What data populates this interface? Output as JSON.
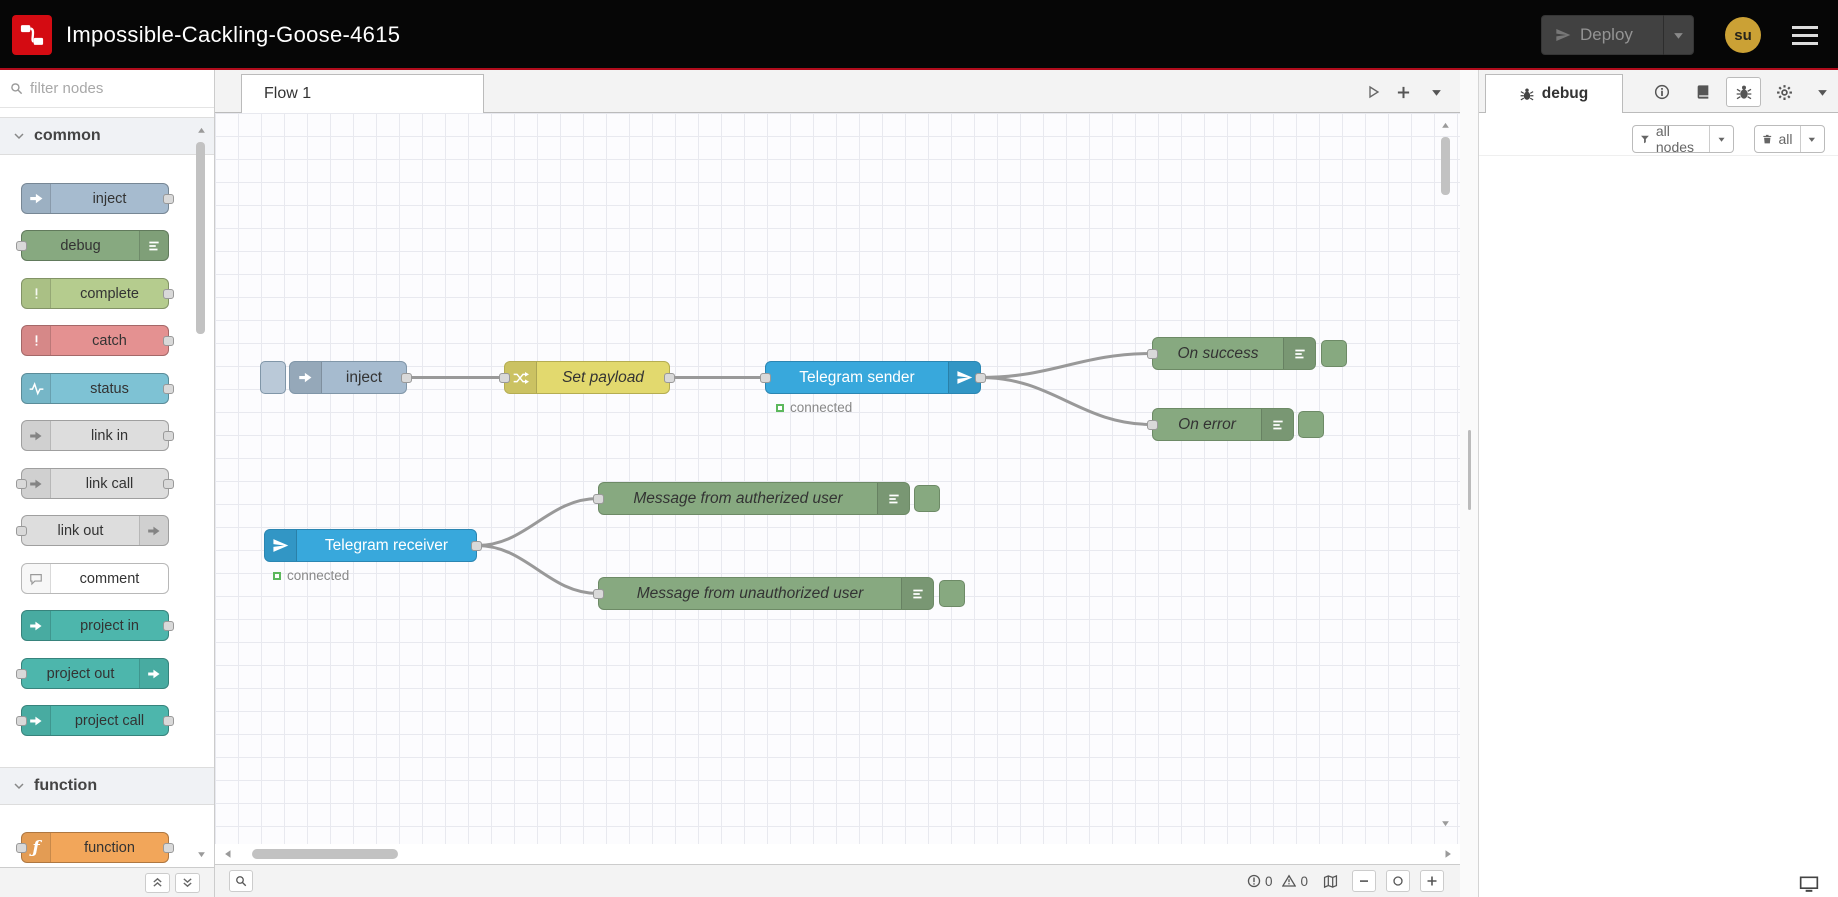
{
  "header": {
    "title": "Impossible-Cackling-Goose-4615",
    "deploy_label": "Deploy",
    "user_initials": "su"
  },
  "palette": {
    "filter_placeholder": "filter nodes",
    "categories": [
      {
        "label": "common"
      },
      {
        "label": "function"
      }
    ],
    "common_items": [
      "inject",
      "debug",
      "complete",
      "catch",
      "status",
      "link in",
      "link call",
      "link out",
      "comment",
      "project in",
      "project out",
      "project call"
    ],
    "function_items": [
      "function"
    ]
  },
  "workspace": {
    "tab_label": "Flow 1",
    "nodes": {
      "inject": {
        "label": "inject"
      },
      "set_payload": {
        "label": "Set payload"
      },
      "telegram_sender": {
        "label": "Telegram sender",
        "status": "connected"
      },
      "on_success": {
        "label": "On success"
      },
      "on_error": {
        "label": "On error"
      },
      "telegram_receiver": {
        "label": "Telegram receiver",
        "status": "connected"
      },
      "message_authorized": {
        "label": "Message from autherized user"
      },
      "message_unauthorized": {
        "label": "Message from unauthorized user"
      }
    },
    "statusbar": {
      "errors": "0",
      "warnings": "0"
    }
  },
  "sidebar": {
    "tab_label": "debug",
    "filter_button_label": "all nodes",
    "clear_button_label": "all"
  },
  "colors": {
    "header_bg": "#060606",
    "header_accent": "#b10c1c",
    "logo_red": "#d40b12",
    "avatar_gold": "#cba135",
    "node_inject": "#a6bbcf",
    "node_debug_green": "#87a980",
    "node_complete": "#b5cc8e",
    "node_catch": "#e49191",
    "node_status": "#7ec2d4",
    "node_link": "#dddddd",
    "node_comment": "#ffffff",
    "node_project": "#4db6ac",
    "node_function": "#f2a65a",
    "node_telegram_blue": "#38a8dc",
    "node_change_yellow": "#e2d96e",
    "status_connected_green": "#5cb85c",
    "wire": "#999999"
  },
  "icons": {
    "search": "magnifier-shape",
    "menu": "hamburger-bars",
    "deploy": "paper-plane",
    "telegram": "paper-plane",
    "inject": "arrow-right",
    "debug_list": "list-lines",
    "catch_complete": "exclamation-mark",
    "status_pulse": "heartbeat-line",
    "link": "arrow-right",
    "comment": "speech-bubble",
    "change": "shuffle-arrows",
    "function_glyph": "ƒ",
    "bug": "bug-shape",
    "info": "circle-i",
    "book": "book-shape",
    "gear": "gear-shape",
    "funnel": "funnel-shape",
    "trash": "trash-can",
    "map": "folded-map",
    "monitor": "monitor-screen"
  }
}
